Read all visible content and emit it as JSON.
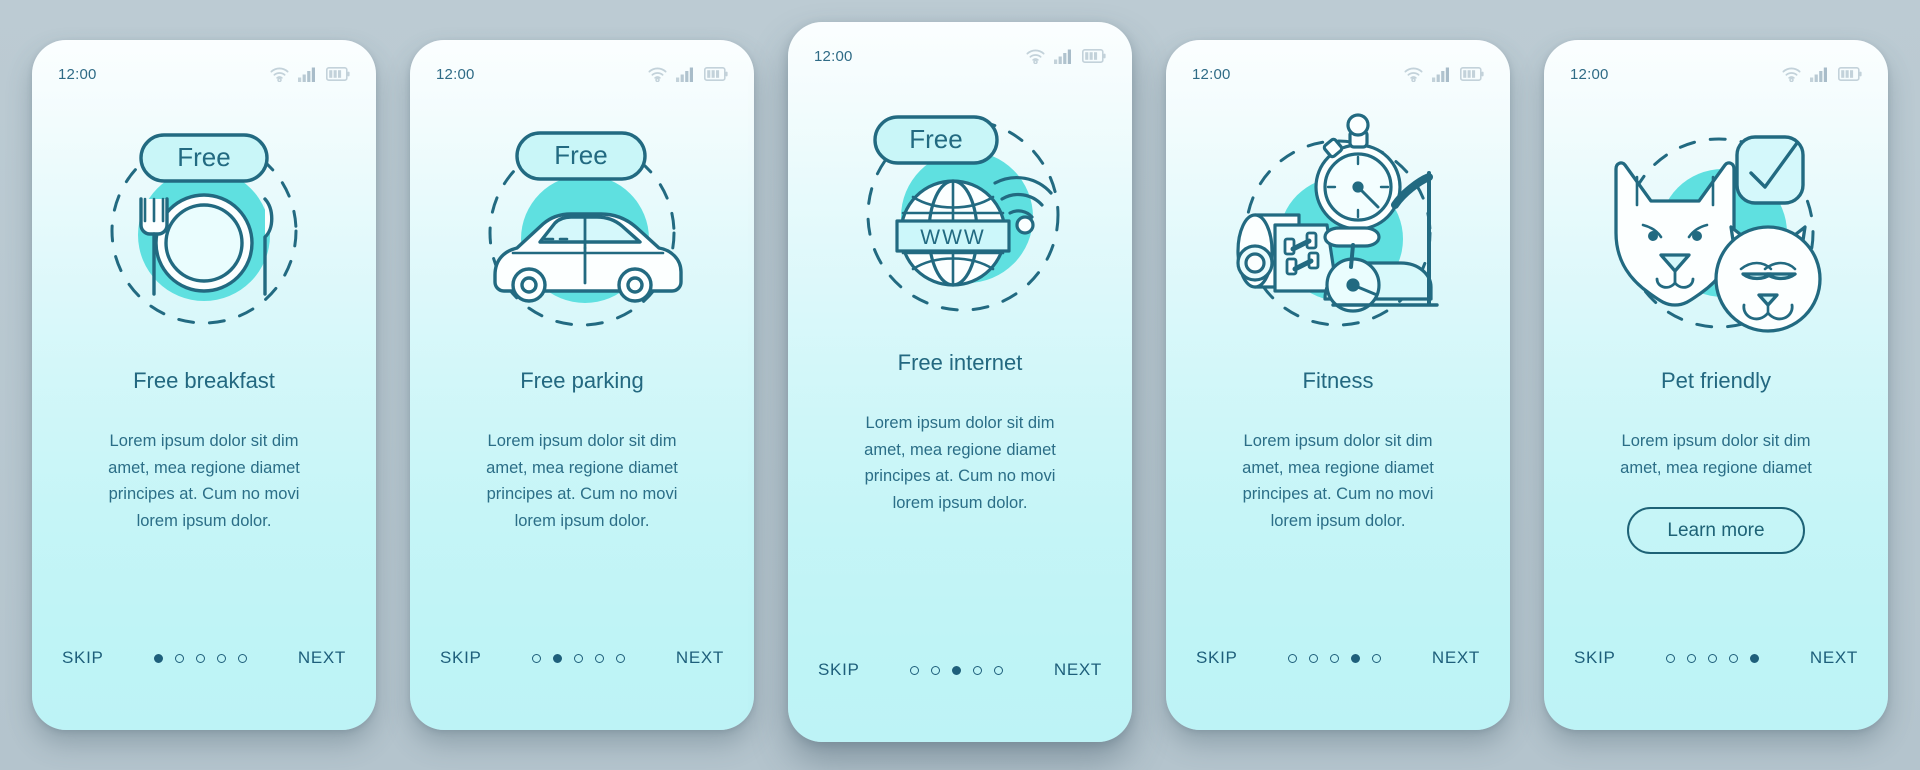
{
  "background_color": "#b8c7d0",
  "accent_color": "#5fe0e0",
  "stroke_color": "#226a81",
  "text_color": "#2b6e87",
  "screens": [
    {
      "status": {
        "time": "12:00",
        "wifi_icon": "wifi-icon",
        "signal_icon": "cellular-signal-icon",
        "battery_icon": "battery-icon"
      },
      "illustration": "free-breakfast-illustration",
      "badge": "Free",
      "title": "Free breakfast",
      "description": "Lorem ipsum dolor sit dim\namet, mea regione diamet\nprincipes at. Cum no movi\nlorem ipsum dolor.",
      "skip_label": "SKIP",
      "next_label": "NEXT",
      "dots_total": 5,
      "dot_active": 1,
      "cta": null
    },
    {
      "status": {
        "time": "12:00",
        "wifi_icon": "wifi-icon",
        "signal_icon": "cellular-signal-icon",
        "battery_icon": "battery-icon"
      },
      "illustration": "free-parking-illustration",
      "badge": "Free",
      "title": "Free parking",
      "description": "Lorem ipsum dolor sit dim\namet, mea regione diamet\nprincipes at. Cum no movi\nlorem ipsum dolor.",
      "skip_label": "SKIP",
      "next_label": "NEXT",
      "dots_total": 5,
      "dot_active": 2,
      "cta": null
    },
    {
      "status": {
        "time": "12:00",
        "wifi_icon": "wifi-icon",
        "signal_icon": "cellular-signal-icon",
        "battery_icon": "battery-icon"
      },
      "illustration": "free-internet-illustration",
      "badge": "Free",
      "globe_label": "WWW",
      "title": "Free internet",
      "description": "Lorem ipsum dolor sit dim\namet, mea regione diamet\nprincipes at. Cum no movi\nlorem ipsum dolor.",
      "skip_label": "SKIP",
      "next_label": "NEXT",
      "dots_total": 5,
      "dot_active": 3,
      "cta": null
    },
    {
      "status": {
        "time": "12:00",
        "wifi_icon": "wifi-icon",
        "signal_icon": "cellular-signal-icon",
        "battery_icon": "battery-icon"
      },
      "illustration": "fitness-illustration",
      "badge": null,
      "title": "Fitness",
      "description": "Lorem ipsum dolor sit dim\namet, mea regione diamet\nprincipes at. Cum no movi\nlorem ipsum dolor.",
      "skip_label": "SKIP",
      "next_label": "NEXT",
      "dots_total": 5,
      "dot_active": 4,
      "cta": null
    },
    {
      "status": {
        "time": "12:00",
        "wifi_icon": "wifi-icon",
        "signal_icon": "cellular-signal-icon",
        "battery_icon": "battery-icon"
      },
      "illustration": "pet-friendly-illustration",
      "badge": null,
      "title": "Pet friendly",
      "description": "Lorem ipsum dolor sit dim\namet, mea regione diamet",
      "skip_label": "SKIP",
      "next_label": "NEXT",
      "dots_total": 5,
      "dot_active": 5,
      "cta": "Learn more"
    }
  ]
}
